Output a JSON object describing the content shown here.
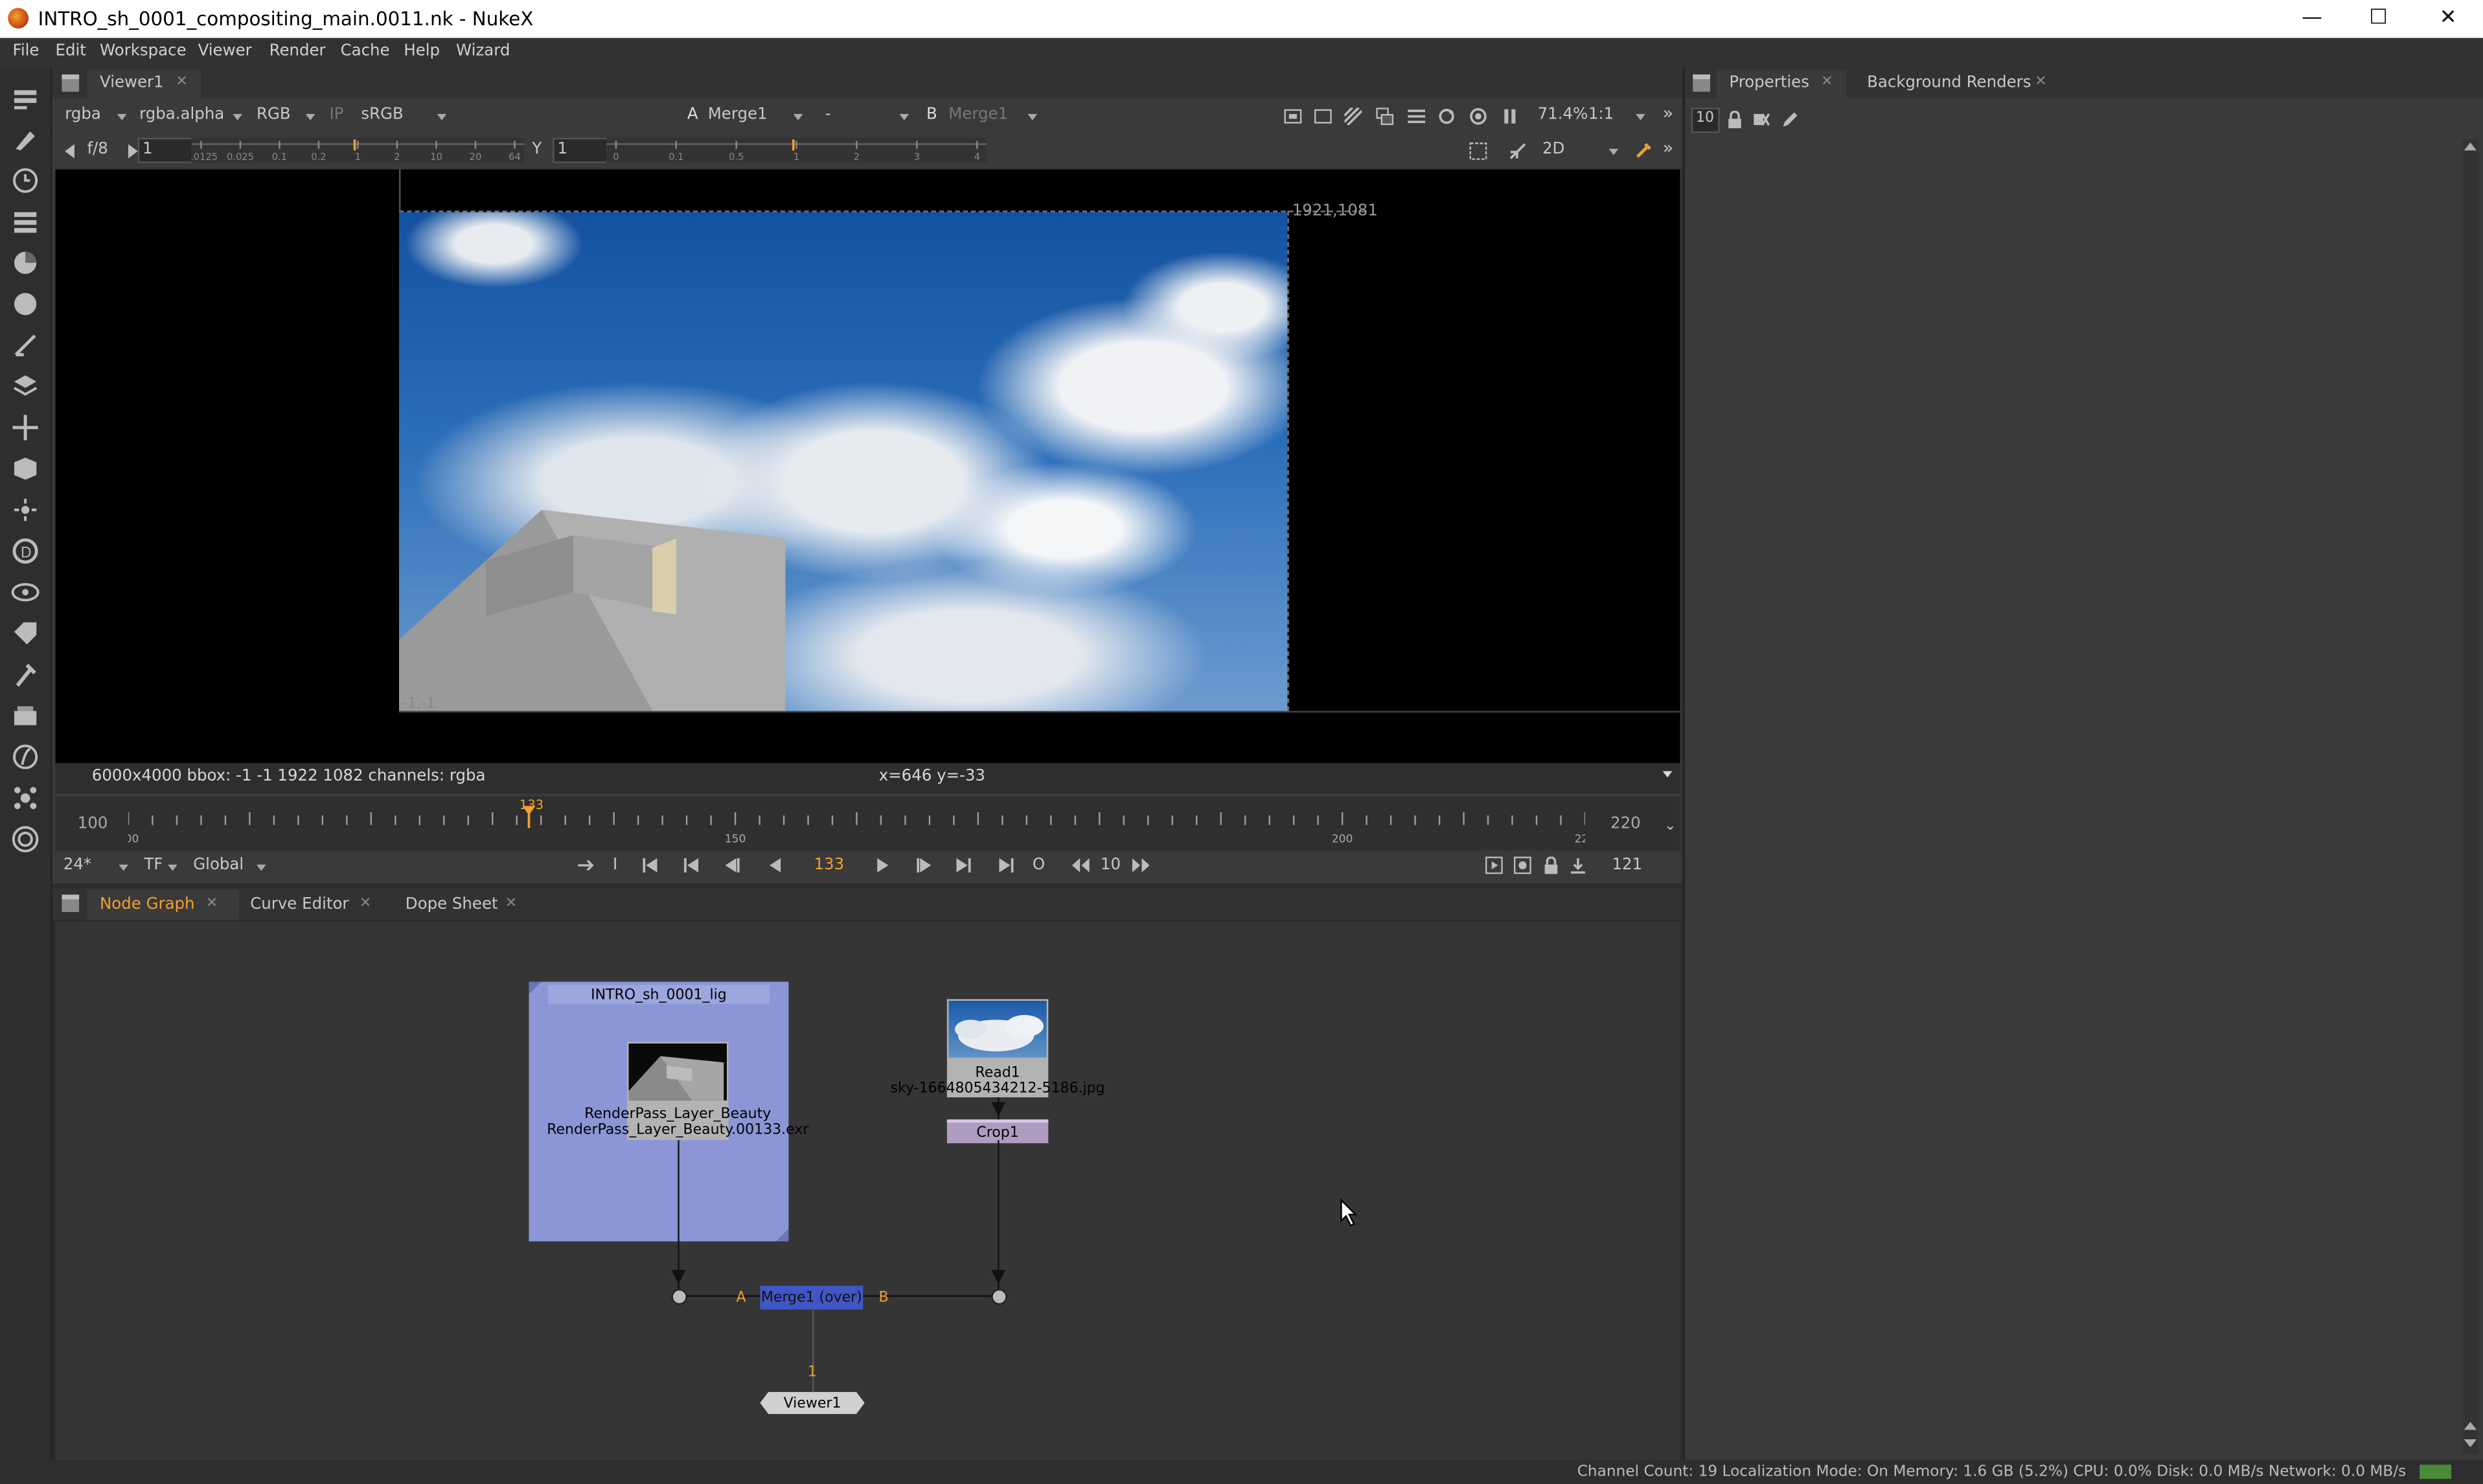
{
  "window": {
    "title": "INTRO_sh_0001_compositing_main.0011.nk - NukeX",
    "minimize": "—",
    "maximize": "☐",
    "close": "✕"
  },
  "menu": [
    "File",
    "Edit",
    "Workspace",
    "Viewer",
    "Render",
    "Cache",
    "Help",
    "Wizard"
  ],
  "viewer_tab": "Viewer1",
  "viewer_controls": {
    "channels": "rgba",
    "alpha_channel": "rgba.alpha",
    "display": "RGB",
    "ip": "IP",
    "lut": "sRGB",
    "a_label": "A",
    "a_input": "Merge1",
    "dash": "-",
    "b_label": "B",
    "b_input": "Merge1",
    "zoom": "71.4%",
    "ratio": "1:1",
    "fstop": "f/8",
    "gain": "1",
    "y_label": "Y",
    "gamma": "1",
    "view_mode": "2D",
    "gain_ticks": [
      "0.0125",
      "0.025",
      "0.1",
      "0.2",
      "1",
      "2",
      "10",
      "20",
      "64"
    ],
    "gamma_ticks": [
      "0",
      "0.1",
      "0.5",
      "1",
      "2",
      "3",
      "4"
    ]
  },
  "viewer": {
    "top_right_coord": "1921,1081",
    "bottom_left_coord": "-1,-1",
    "info": "6000x4000  bbox: -1 -1 1922 1082 channels: rgba",
    "cursor": "x=646 y=-33"
  },
  "timeline": {
    "start": "100",
    "end": "220",
    "current": "133",
    "tick_labels": [
      "100",
      "150",
      "200",
      "220"
    ],
    "current_fraction": 0.275
  },
  "playback": {
    "fps": "24*",
    "tf": "TF",
    "range_mode": "Global",
    "frame": "133",
    "step": "10",
    "out_frame": "121",
    "o_label": "O",
    "i_label": "I"
  },
  "bottom_tabs": [
    "Node Graph",
    "Curve Editor",
    "Dope Sheet"
  ],
  "right_tabs": [
    "Properties",
    "Background Renders"
  ],
  "properties_count": "10",
  "nodes": {
    "backdrop": "INTRO_sh_0001_lig",
    "read_exr_name": "RenderPass_Layer_Beauty",
    "read_exr_file": "RenderPass_Layer_Beauty.00133.exr",
    "read1_name": "Read1",
    "read1_file": "sky-1664805434212-5186.jpg",
    "crop": "Crop1",
    "merge": "Merge1 (over)",
    "merge_a": "A",
    "merge_b": "B",
    "viewer_input": "1",
    "viewer_node": "Viewer1"
  },
  "statusbar": "Channel Count: 19  Localization Mode: On  Memory: 1.6 GB (5.2%)  CPU: 0.0%  Disk: 0.0 MB/s  Network: 0.0 MB/s",
  "colors": {
    "accent_orange": "#f0a030",
    "backdrop": "#8c96d6",
    "merge_node": "#3f56c4",
    "crop_node": "#b09cc0"
  }
}
